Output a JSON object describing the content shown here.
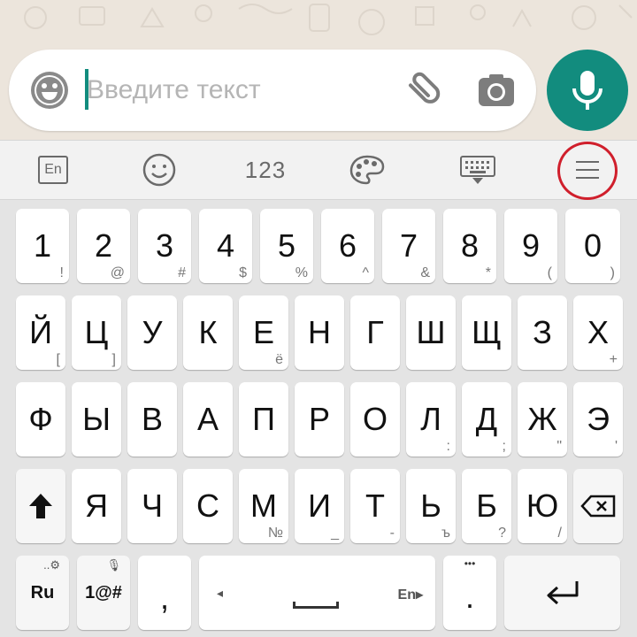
{
  "input": {
    "placeholder": "Введите текст"
  },
  "toolbar": {
    "lang_label": "En",
    "numbers_label": "123"
  },
  "keyboard": {
    "number_row": [
      {
        "main": "1",
        "sub": "!"
      },
      {
        "main": "2",
        "sub": "@"
      },
      {
        "main": "3",
        "sub": "#"
      },
      {
        "main": "4",
        "sub": "$"
      },
      {
        "main": "5",
        "sub": "%"
      },
      {
        "main": "6",
        "sub": "^"
      },
      {
        "main": "7",
        "sub": "&"
      },
      {
        "main": "8",
        "sub": "*"
      },
      {
        "main": "9",
        "sub": "("
      },
      {
        "main": "0",
        "sub": ")"
      }
    ],
    "row1": [
      {
        "main": "Й",
        "sub": "["
      },
      {
        "main": "Ц",
        "sub": "]"
      },
      {
        "main": "У",
        "sub": ""
      },
      {
        "main": "К",
        "sub": ""
      },
      {
        "main": "Е",
        "sub": "ё"
      },
      {
        "main": "Н",
        "sub": ""
      },
      {
        "main": "Г",
        "sub": ""
      },
      {
        "main": "Ш",
        "sub": ""
      },
      {
        "main": "Щ",
        "sub": ""
      },
      {
        "main": "З",
        "sub": ""
      },
      {
        "main": "Х",
        "sub": "+"
      }
    ],
    "row2": [
      {
        "main": "Ф",
        "sub": ""
      },
      {
        "main": "Ы",
        "sub": ""
      },
      {
        "main": "В",
        "sub": ""
      },
      {
        "main": "А",
        "sub": ""
      },
      {
        "main": "П",
        "sub": ""
      },
      {
        "main": "Р",
        "sub": ""
      },
      {
        "main": "О",
        "sub": ""
      },
      {
        "main": "Л",
        "sub": ":"
      },
      {
        "main": "Д",
        "sub": ";"
      },
      {
        "main": "Ж",
        "sub": "\""
      },
      {
        "main": "Э",
        "sub": "'"
      }
    ],
    "row3": [
      {
        "main": "Я",
        "sub": ""
      },
      {
        "main": "Ч",
        "sub": ""
      },
      {
        "main": "С",
        "sub": ""
      },
      {
        "main": "М",
        "sub": "№"
      },
      {
        "main": "И",
        "sub": "_"
      },
      {
        "main": "Т",
        "sub": "-"
      },
      {
        "main": "Ь",
        "sub": "ъ"
      },
      {
        "main": "Б",
        "sub": "?"
      },
      {
        "main": "Ю",
        "sub": "/"
      }
    ],
    "bottom": {
      "lang_key": "Ru",
      "symbols_key": "1@#",
      "comma_key": ",",
      "space_left_arrow": "◂",
      "space_lang": "En▸",
      "period_key": ".",
      "period_dots": "•••"
    }
  },
  "colors": {
    "accent": "#128c7e",
    "highlight": "#d01f2c"
  }
}
